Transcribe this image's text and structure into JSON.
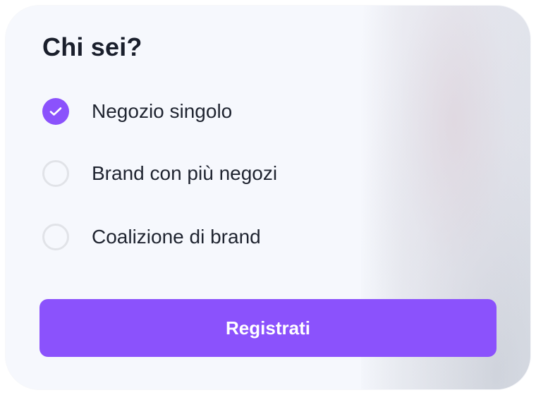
{
  "form": {
    "title": "Chi sei?",
    "options": [
      {
        "label": "Negozio singolo",
        "checked": true
      },
      {
        "label": "Brand con più negozi",
        "checked": false
      },
      {
        "label": "Coalizione di brand",
        "checked": false
      }
    ],
    "submit_label": "Registrati"
  },
  "colors": {
    "accent": "#8b52fc",
    "title_text": "#1a1f2c",
    "radio_border": "#e1e3e8",
    "card_background": "#f6f8fd"
  },
  "icons": {
    "checked_radio": "check-icon"
  }
}
